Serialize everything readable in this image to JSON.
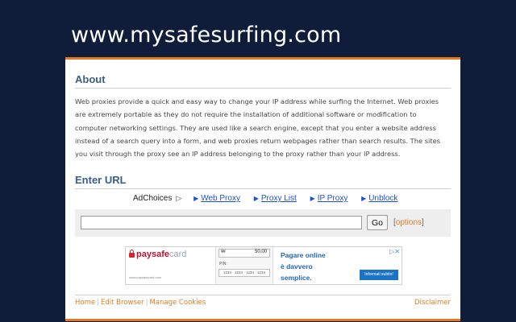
{
  "site": {
    "title": "www.mysafesurfing.com"
  },
  "about": {
    "heading": "About",
    "text": "Web proxies provide a quick and easy way to change your IP address while surfing the Internet. Web proxies are extremely portable as they do not require the installation of additional software or modification to computer networking settings. They are used like a search engine, except that you enter a website address instead of a search query into a form, and web proxies return webpages rather than search results. The sites you visit through the proxy see an IP address belonging to the proxy rather than your IP address."
  },
  "enter_url": {
    "heading": "Enter URL",
    "adchoices": "AdChoices",
    "links": [
      "Web Proxy",
      "Proxy List",
      "IP Proxy",
      "Unblock"
    ],
    "input_value": "",
    "go_label": "Go",
    "options_open": "[",
    "options_label": "options",
    "options_close": "]"
  },
  "ad": {
    "brand_bold": "paysafe",
    "brand_light": "card",
    "brand_url": "www.paysafecard.com",
    "card_amount": "50.00",
    "card_currency": "₩",
    "pin_label": "PIN:",
    "pin_digits": "1234 · 1234 · 1234 · 1234",
    "line1": "Pagare online",
    "line2": "è davvero",
    "line3": "semplice.",
    "cta": "Informati subito!",
    "close": "▷✕"
  },
  "footer": {
    "links": [
      "Home",
      "Edit Browser",
      "Manage Cookies"
    ],
    "disclaimer": "Disclaimer"
  },
  "colors": {
    "background": "#0f1d3a",
    "accent": "#e07b24",
    "heading": "#3b5e86",
    "link": "#1a4fd6"
  }
}
